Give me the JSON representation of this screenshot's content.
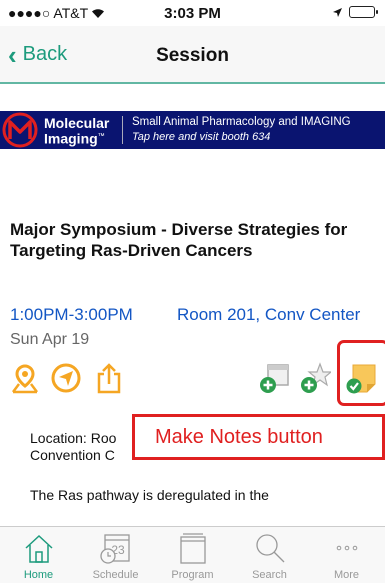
{
  "status_bar": {
    "carrier": "●●●●○ AT&T",
    "time": "3:03 PM"
  },
  "nav": {
    "back_label": "Back",
    "title": "Session"
  },
  "banner": {
    "brand_line1": "Molecular",
    "brand_line2": "Imaging",
    "trademark": "™",
    "tagline": "Small Animal Pharmacology and IMAGING",
    "subline": "Tap here and visit booth 634"
  },
  "session": {
    "title": "Major Symposium - Diverse Strategies for Targeting Ras-Driven Cancers",
    "time": "1:00PM-3:00PM",
    "room": "Room 201, Conv Center",
    "date": "Sun Apr 19",
    "location_line1": "Location: Roo",
    "location_line2": "Convention C",
    "description": "The Ras pathway is deregulated in the"
  },
  "actions": [
    {
      "icon": "map-pin-icon"
    },
    {
      "icon": "navigate-icon"
    },
    {
      "icon": "share-icon"
    },
    {
      "icon": "add-to-schedule-icon"
    },
    {
      "icon": "add-to-favorites-icon"
    },
    {
      "icon": "make-notes-icon"
    }
  ],
  "annotation": {
    "label": "Make Notes button"
  },
  "tabs": [
    {
      "label": "Home",
      "active": true
    },
    {
      "label": "Schedule",
      "calendar_day": "23"
    },
    {
      "label": "Program"
    },
    {
      "label": "Search"
    },
    {
      "label": "More"
    }
  ],
  "colors": {
    "accent": "#1d9b7d",
    "link": "#1356c4",
    "action_orange": "#f5a623",
    "annotation_red": "#e02020",
    "banner_bg": "#0a1470"
  }
}
